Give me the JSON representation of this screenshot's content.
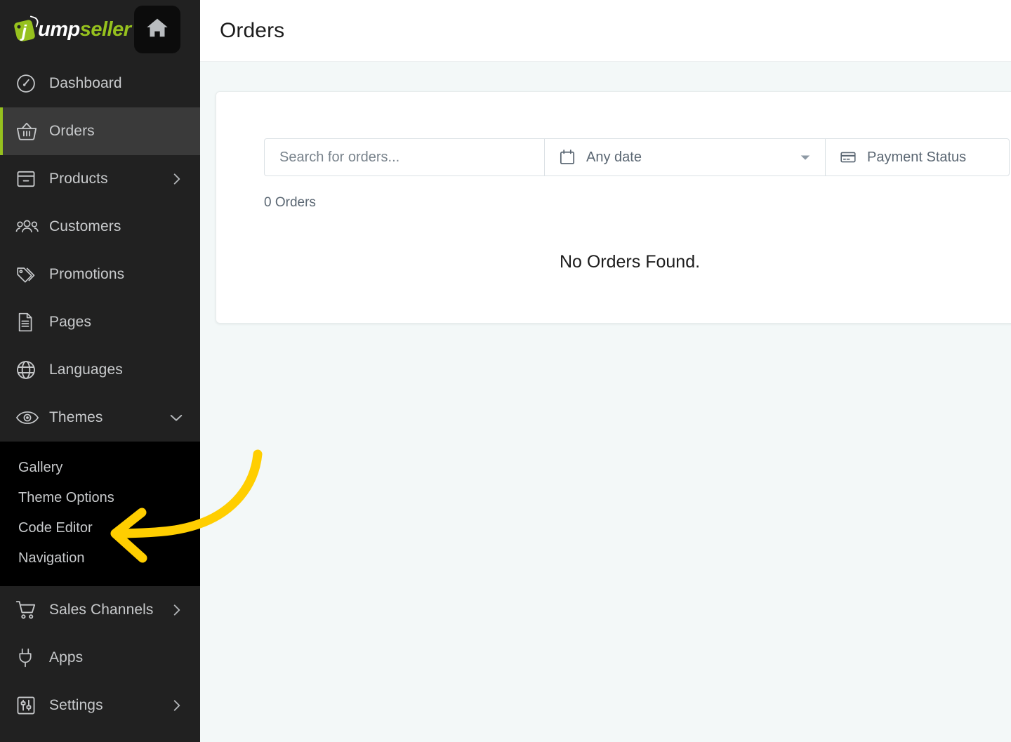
{
  "brand": {
    "logo_text_1": "ump",
    "logo_text_2": "seller",
    "logo_j": "j",
    "home_icon": "home-icon"
  },
  "sidebar": {
    "items": [
      {
        "label": "Dashboard",
        "icon": "gauge-icon",
        "active": false,
        "chevron": ""
      },
      {
        "label": "Orders",
        "icon": "basket-icon",
        "active": true,
        "chevron": ""
      },
      {
        "label": "Products",
        "icon": "box-icon",
        "active": false,
        "chevron": "right"
      },
      {
        "label": "Customers",
        "icon": "users-icon",
        "active": false,
        "chevron": ""
      },
      {
        "label": "Promotions",
        "icon": "tags-icon",
        "active": false,
        "chevron": ""
      },
      {
        "label": "Pages",
        "icon": "document-icon",
        "active": false,
        "chevron": ""
      },
      {
        "label": "Languages",
        "icon": "globe-icon",
        "active": false,
        "chevron": ""
      },
      {
        "label": "Themes",
        "icon": "eye-icon",
        "active": false,
        "chevron": "down"
      }
    ],
    "submenu": [
      {
        "label": "Gallery"
      },
      {
        "label": "Theme Options"
      },
      {
        "label": "Code Editor"
      },
      {
        "label": "Navigation"
      }
    ],
    "items_bottom": [
      {
        "label": "Sales Channels",
        "icon": "cart-icon",
        "active": false,
        "chevron": "right"
      },
      {
        "label": "Apps",
        "icon": "plug-icon",
        "active": false,
        "chevron": ""
      },
      {
        "label": "Settings",
        "icon": "sliders-icon",
        "active": false,
        "chevron": "right"
      }
    ]
  },
  "header": {
    "title": "Orders"
  },
  "filters": {
    "search_value": "",
    "search_placeholder": "Search for orders...",
    "date_label": "Any date",
    "date_icon": "calendar-icon",
    "payment_label": "Payment Status",
    "payment_icon": "credit-card-icon",
    "caret_icon": "chevron-down-icon"
  },
  "list": {
    "count_label": "0 Orders",
    "empty_label": "No Orders Found."
  },
  "annotation": {
    "arrow_color": "#FFCE00",
    "points_at": "Code Editor"
  },
  "colors": {
    "accent_green": "#96c11e",
    "sidebar_bg": "#212121",
    "submenu_bg": "#000000",
    "page_bg": "#f3f8f8",
    "arrow_yellow": "#FFCE00"
  }
}
